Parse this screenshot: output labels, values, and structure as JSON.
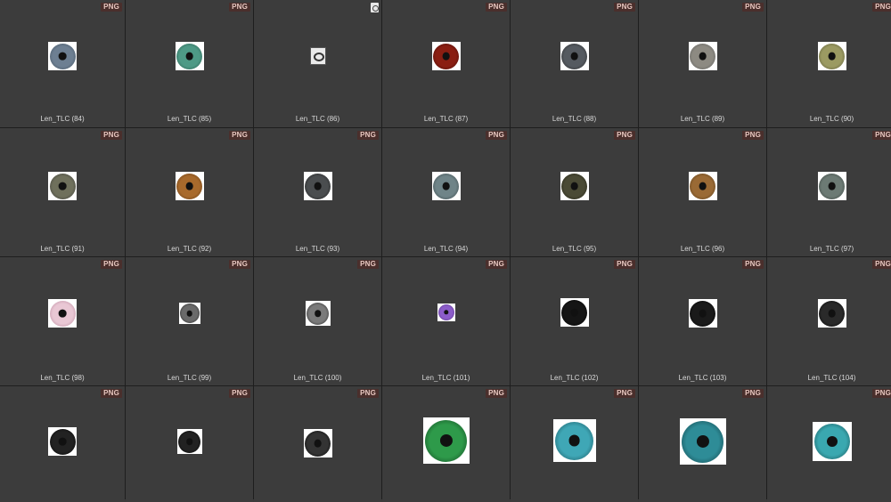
{
  "badge_text": "PNG",
  "items": [
    {
      "label": "Len_TLC (84)",
      "iris": "#6d7f92",
      "ring": "#3b4a58",
      "type": "PNG"
    },
    {
      "label": "Len_TLC (85)",
      "iris": "#4e9a86",
      "ring": "#245447",
      "type": "PNG"
    },
    {
      "label": "Len_TLC (86)",
      "iris": null,
      "ring": null,
      "type": "file"
    },
    {
      "label": "Len_TLC (87)",
      "iris": "#8a1e12",
      "ring": "#3a0a06",
      "type": "PNG"
    },
    {
      "label": "Len_TLC (88)",
      "iris": "#555a60",
      "ring": "#222",
      "type": "PNG"
    },
    {
      "label": "Len_TLC (89)",
      "iris": "#8d8a82",
      "ring": "#555",
      "type": "PNG"
    },
    {
      "label": "Len_TLC (90)",
      "iris": "#9b9a62",
      "ring": "#4e4d2e",
      "type": "PNG"
    },
    {
      "label": "Len_TLC (91)",
      "iris": "#6f705c",
      "ring": "#333",
      "type": "PNG"
    },
    {
      "label": "Len_TLC (92)",
      "iris": "#a86a2c",
      "ring": "#5a3512",
      "type": "PNG"
    },
    {
      "label": "Len_TLC (93)",
      "iris": "#4a4d4f",
      "ring": "#1a1a1a",
      "type": "PNG"
    },
    {
      "label": "Len_TLC (94)",
      "iris": "#6f8488",
      "ring": "#2e3a3c",
      "type": "PNG"
    },
    {
      "label": "Len_TLC (95)",
      "iris": "#4a4a35",
      "ring": "#1c1c10",
      "type": "PNG"
    },
    {
      "label": "Len_TLC (96)",
      "iris": "#9a6a35",
      "ring": "#4e3414",
      "type": "PNG"
    },
    {
      "label": "Len_TLC (97)",
      "iris": "#6c7a74",
      "ring": "#2f3733",
      "type": "PNG"
    },
    {
      "label": "Len_TLC (98)",
      "iris": "#e9c7d4",
      "ring": "#b07d92",
      "type": "PNG"
    },
    {
      "label": "Len_TLC (99)",
      "iris": "#6a6a6a",
      "ring": "#111",
      "type": "PNG"
    },
    {
      "label": "Len_TLC (100)",
      "iris": "#7a7a7a",
      "ring": "#111",
      "type": "PNG"
    },
    {
      "label": "Len_TLC (101)",
      "iris": "#8b5cc9",
      "ring": "#3f2166",
      "type": "PNG"
    },
    {
      "label": "Len_TLC (102)",
      "iris": "#151515",
      "ring": "#000",
      "type": "PNG"
    },
    {
      "label": "Len_TLC (103)",
      "iris": "#1a1a1a",
      "ring": "#000",
      "type": "PNG"
    },
    {
      "label": "Len_TLC (104)",
      "iris": "#2a2a2a",
      "ring": "#000",
      "type": "PNG"
    },
    {
      "label": "",
      "iris": "#222",
      "ring": "#000",
      "type": "PNG"
    },
    {
      "label": "",
      "iris": "#222",
      "ring": "#000",
      "type": "PNG"
    },
    {
      "label": "",
      "iris": "#333",
      "ring": "#000",
      "type": "PNG"
    },
    {
      "label": "",
      "iris": "#2e9a4a",
      "ring": "#0e3f1c",
      "type": "PNG"
    },
    {
      "label": "",
      "iris": "#3fa7b6",
      "ring": "#144b54",
      "type": "PNG"
    },
    {
      "label": "",
      "iris": "#2e8c97",
      "ring": "#0f3a40",
      "type": "PNG"
    },
    {
      "label": "",
      "iris": "#3aa8b0",
      "ring": "#124548",
      "type": "PNG"
    }
  ]
}
